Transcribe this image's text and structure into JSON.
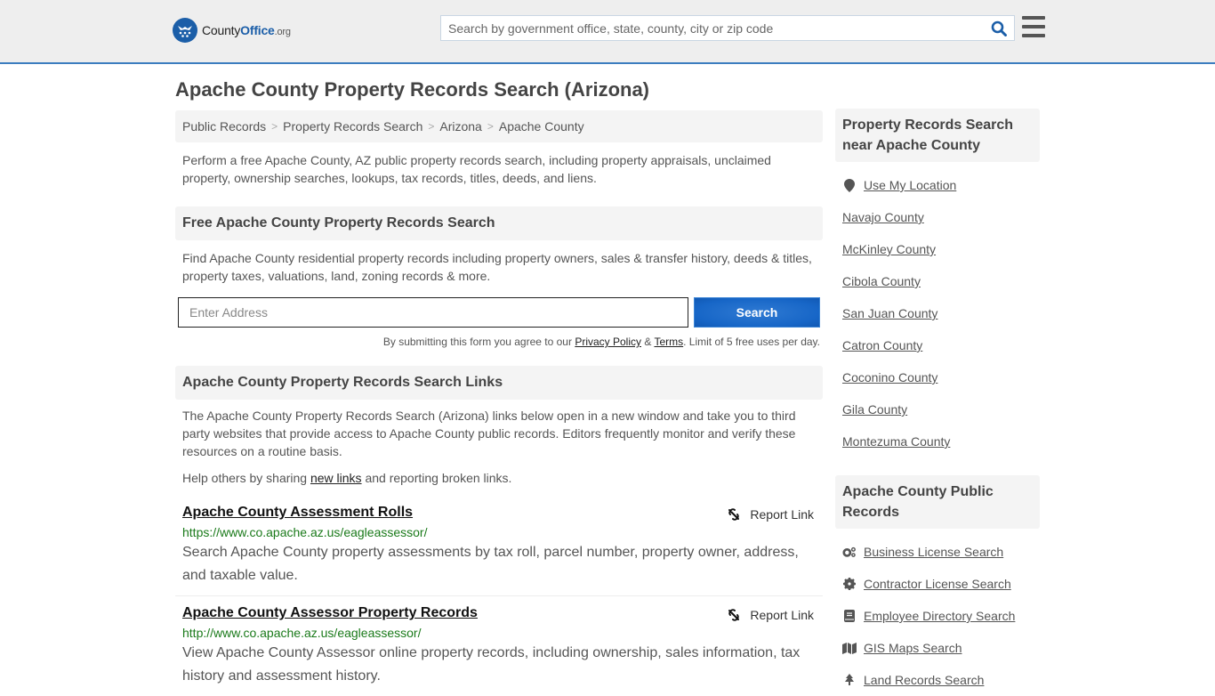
{
  "header": {
    "logo_county": "County",
    "logo_office": "Office",
    "logo_org": ".org",
    "search_placeholder": "Search by government office, state, county, city or zip code",
    "search_icon": "search-icon",
    "menu_icon": "hamburger-menu-icon"
  },
  "page": {
    "title": "Apache County Property Records Search (Arizona)"
  },
  "breadcrumb": [
    {
      "label": "Public Records"
    },
    {
      "label": "Property Records Search"
    },
    {
      "label": "Arizona"
    },
    {
      "label": "Apache County"
    }
  ],
  "intro": "Perform a free Apache County, AZ public property records search, including property appraisals, unclaimed property, ownership searches, lookups, tax records, titles, deeds, and liens.",
  "free_search": {
    "heading": "Free Apache County Property Records Search",
    "description": "Find Apache County residential property records including property owners, sales & transfer history, deeds & titles, property taxes, valuations, land, zoning records & more.",
    "address_placeholder": "Enter Address",
    "address_value": "",
    "button_label": "Search",
    "disclaimer_pre": "By submitting this form you agree to our ",
    "privacy_label": "Privacy Policy",
    "disclaimer_amp": " & ",
    "terms_label": "Terms",
    "disclaimer_post": ". Limit of 5 free uses per day."
  },
  "links_section": {
    "heading": "Apache County Property Records Search Links",
    "description": "The Apache County Property Records Search (Arizona) links below open in a new window and take you to third party websites that provide access to Apache County public records. Editors frequently monitor and verify these resources on a routine basis.",
    "help_pre": "Help others by sharing ",
    "help_link": "new links",
    "help_post": " and reporting broken links.",
    "report_label": "Report Link",
    "results": [
      {
        "title": "Apache County Assessment Rolls",
        "url": "https://www.co.apache.az.us/eagleassessor/",
        "description": "Search Apache County property assessments by tax roll, parcel number, property owner, address, and taxable value."
      },
      {
        "title": "Apache County Assessor Property Records",
        "url": "http://www.co.apache.az.us/eagleassessor/",
        "description": "View Apache County Assessor online property records, including ownership, sales information, tax history and assessment history."
      }
    ]
  },
  "sidebar": {
    "nearby_heading": "Property Records Search near Apache County",
    "use_location": "Use My Location",
    "nearby": [
      {
        "label": "Navajo County"
      },
      {
        "label": "McKinley County"
      },
      {
        "label": "Cibola County"
      },
      {
        "label": "San Juan County"
      },
      {
        "label": "Catron County"
      },
      {
        "label": "Coconino County"
      },
      {
        "label": "Gila County"
      },
      {
        "label": "Montezuma County"
      }
    ],
    "public_heading": "Apache County Public Records",
    "public_records": [
      {
        "label": "Business License Search",
        "icon": "cogs-icon"
      },
      {
        "label": "Contractor License Search",
        "icon": "gear-icon"
      },
      {
        "label": "Employee Directory Search",
        "icon": "book-icon"
      },
      {
        "label": "GIS Maps Search",
        "icon": "map-icon"
      },
      {
        "label": "Land Records Search",
        "icon": "tree-icon"
      }
    ]
  },
  "colors": {
    "brand_blue": "#1b5ea8",
    "header_border": "#3b7dbf",
    "button_blue": "#1766c7",
    "url_green": "#1a7a1a"
  }
}
